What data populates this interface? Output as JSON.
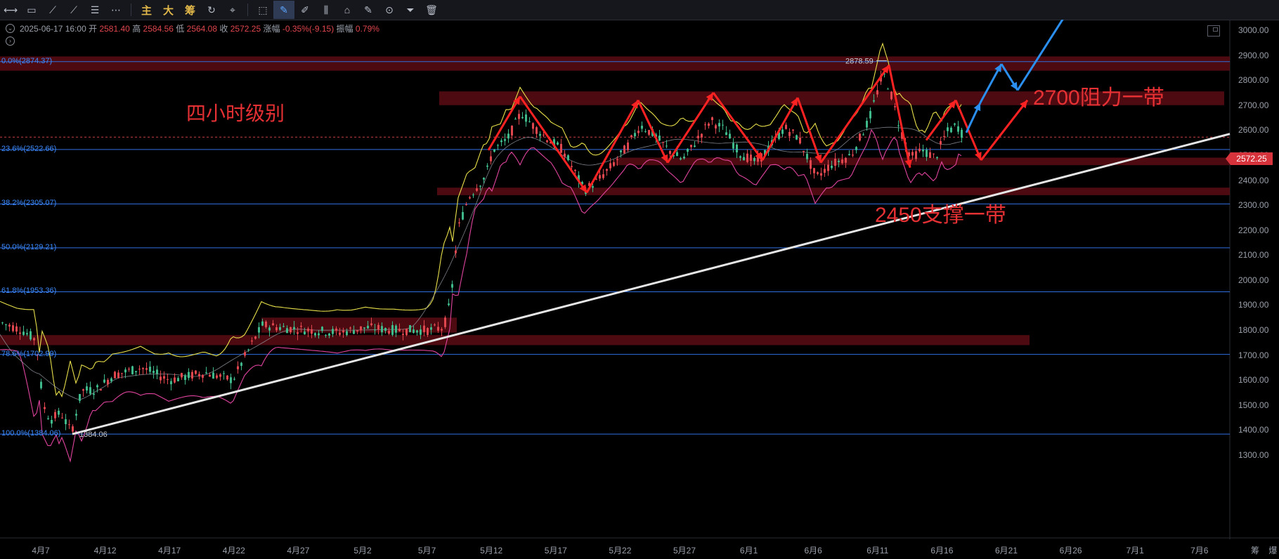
{
  "toolbar": {
    "tools": [
      {
        "name": "horizontal-line-icon",
        "glyph": "⟷"
      },
      {
        "name": "rectangle-icon",
        "glyph": "▭"
      },
      {
        "name": "trend-line-icon",
        "glyph": "⟋"
      },
      {
        "name": "ray-line-icon",
        "glyph": "⟋"
      },
      {
        "name": "parallel-channel-icon",
        "glyph": "☰"
      },
      {
        "name": "more-icon",
        "glyph": "⋯"
      }
    ],
    "text_buttons": [
      "主",
      "大",
      "筹"
    ],
    "right_tools": [
      {
        "name": "cycle-icon",
        "glyph": "↻"
      },
      {
        "name": "measure-icon",
        "glyph": "⌖"
      },
      {
        "name": "select-icon",
        "glyph": "⬚"
      },
      {
        "name": "pencil-icon",
        "glyph": "✎"
      },
      {
        "name": "pen-icon",
        "glyph": "✐"
      },
      {
        "name": "candles-icon",
        "glyph": "⫼"
      },
      {
        "name": "lock-icon",
        "glyph": "⌂"
      },
      {
        "name": "edit-icon",
        "glyph": "✎"
      },
      {
        "name": "magnet-icon",
        "glyph": "⊙"
      },
      {
        "name": "filter-icon",
        "glyph": "⏷"
      },
      {
        "name": "trash-icon",
        "glyph": "🗑"
      }
    ]
  },
  "info": {
    "datetime": "2025-06-17 16:00",
    "open_label": "开",
    "open": "2581.40",
    "high_label": "高",
    "high": "2584.56",
    "low_label": "低",
    "low": "2564.08",
    "close_label": "收",
    "close": "2572.25",
    "change_label": "涨幅",
    "change": "-0.35%(-9.15)",
    "amp_label": "振幅",
    "amp": "0.79%"
  },
  "fib_levels": [
    {
      "label": "0.0%(2874.37)",
      "price": 2874.37
    },
    {
      "label": "23.6%(2522.66)",
      "price": 2522.66
    },
    {
      "label": "38.2%(2305.07)",
      "price": 2305.07
    },
    {
      "label": "50.0%(2129.21)",
      "price": 2129.21
    },
    {
      "label": "61.8%(1953.36)",
      "price": 1953.36
    },
    {
      "label": "78.6%(1702.99)",
      "price": 1702.99
    },
    {
      "label": "100.0%(1384.06)",
      "price": 1384.06
    }
  ],
  "y_axis": [
    "3000.00",
    "2900.00",
    "2800.00",
    "2700.00",
    "2600.00",
    "2500.00",
    "2400.00",
    "2300.00",
    "2200.00",
    "2100.00",
    "2000.00",
    "1900.00",
    "1800.00",
    "1700.00",
    "1600.00",
    "1500.00",
    "1400.00",
    "1300.00"
  ],
  "x_axis": [
    "4月7",
    "4月12",
    "4月17",
    "4月22",
    "4月27",
    "5月2",
    "5月7",
    "5月12",
    "5月17",
    "5月22",
    "5月27",
    "6月1",
    "6月6",
    "6月11",
    "6月16",
    "6月21",
    "6月26",
    "7月1",
    "7月6"
  ],
  "current_price": "2572.25",
  "high_marker": "2878.59",
  "low_marker": "1384.06",
  "annotations": {
    "timeframe": "四小时级别",
    "resistance": "2700阻力一带",
    "support": "2450支撑一带"
  },
  "bottom_tools": [
    "筹",
    "爆"
  ],
  "colors": {
    "fib": "#2f6fe0",
    "zone": "#5a0d14",
    "trend": "#e6e6e6",
    "arrow_red": "#ff2222",
    "arrow_blue": "#2b8ff0",
    "upper_band": "#e8e04a",
    "lower_band": "#e0449e",
    "mid_band": "#9aa0aa",
    "up_candle": "#3fb88a",
    "down_candle": "#e0464e"
  }
}
